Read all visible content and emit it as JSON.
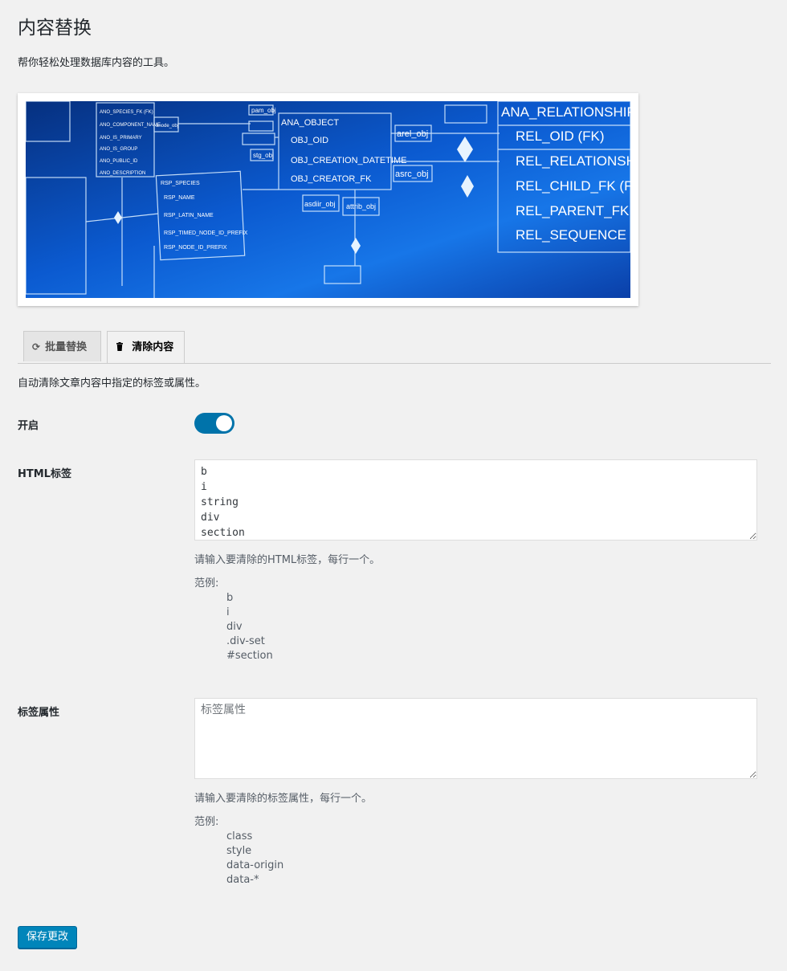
{
  "page": {
    "title": "内容替换",
    "subtitle": "帮你轻松处理数据库内容的工具。"
  },
  "banner": {
    "texts": [
      "ANA_RELATIONSHIP",
      "REL_OID (FK)",
      "REL_RELATIONSHI",
      "REL_CHILD_FK (FK)",
      "REL_PARENT_FK (F",
      "REL_SEQUENCE",
      "ANA_OBJECT",
      "OBJ_OID",
      "OBJ_CREATION_DATETIME",
      "OBJ_CREATOR_FK",
      "arel_obj",
      "asrc_obj",
      "asdiir_obj",
      "attrib_obj",
      "RSP_SPECIES",
      "RSP_NAME",
      "RSP_LATIN_NAME",
      "RSP_TIMED_NODE_ID_PREFIX",
      "RSP_NODE_ID_PREFIX",
      "ANO_SPECIES_FK (FK)",
      "ANO_COMPONENT_NAME",
      "ANO_IS_PRIMARY",
      "ANO_IS_GROUP",
      "ANO_PUBLIC_ID",
      "ANO_DESCRIPTION",
      "anode_obj",
      "stg_obj",
      "pam_obj"
    ]
  },
  "tabs": [
    {
      "label": "批量替换",
      "icon": "refresh-icon"
    },
    {
      "label": "清除内容",
      "icon": "trash-icon"
    }
  ],
  "section_desc": "自动清除文章内容中指定的标签或属性。",
  "enable": {
    "label": "开启",
    "on": true
  },
  "html_tags": {
    "label": "HTML标签",
    "value": "b\ni\nstring\ndiv\nsection",
    "help": "请输入要清除的HTML标签，每行一个。",
    "example_title": "范例:",
    "examples": [
      "b",
      "i",
      "div",
      ".div-set",
      "#section"
    ]
  },
  "tag_attrs": {
    "label": "标签属性",
    "value": "",
    "placeholder": "标签属性",
    "help": "请输入要清除的标签属性，每行一个。",
    "example_title": "范例:",
    "examples": [
      "class",
      "style",
      "data-origin",
      "data-*"
    ]
  },
  "save_label": "保存更改",
  "colors": {
    "accent": "#0085ba",
    "toggle_on": "#0073aa",
    "banner_blue": "#0a3fa8"
  }
}
